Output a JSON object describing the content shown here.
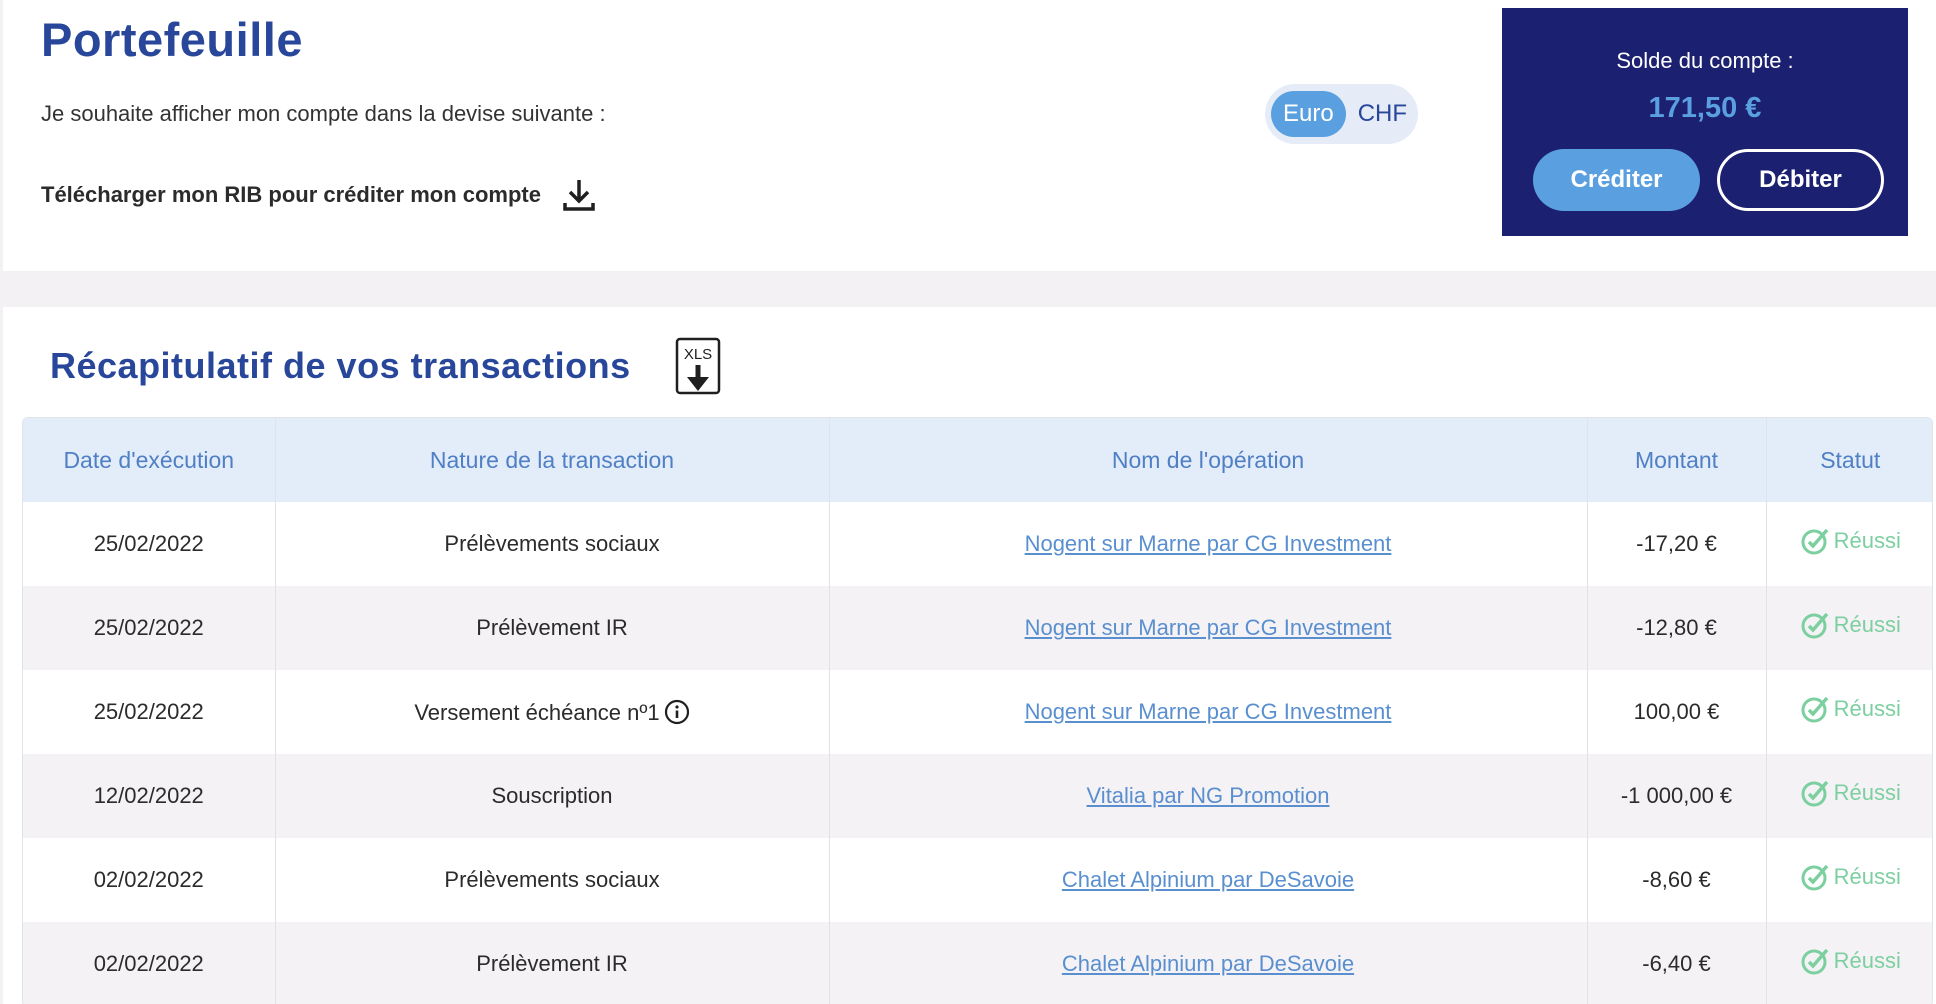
{
  "header": {
    "title": "Portefeuille",
    "currency_label": "Je souhaite afficher mon compte dans la devise suivante :",
    "rib_link": "Télécharger mon RIB pour créditer mon compte"
  },
  "currency_toggle": {
    "options": [
      "Euro",
      "CHF"
    ],
    "selected": "Euro"
  },
  "balance": {
    "label": "Solde du compte :",
    "value": "171,50 €",
    "credit_label": "Créditer",
    "debit_label": "Débiter"
  },
  "transactions": {
    "title": "Récapitulatif de vos transactions",
    "export_label": "XLS",
    "columns": [
      "Date d'exécution",
      "Nature de la transaction",
      "Nom de l'opération",
      "Montant",
      "Statut"
    ],
    "rows": [
      {
        "date": "25/02/2022",
        "nature": "Prélèvements sociaux",
        "operation": "Nogent sur Marne par CG Investment",
        "amount": "-17,20 €",
        "status": "Réussi"
      },
      {
        "date": "25/02/2022",
        "nature": "Prélèvement IR",
        "operation": "Nogent sur Marne par CG Investment",
        "amount": "-12,80 €",
        "status": "Réussi"
      },
      {
        "date": "25/02/2022",
        "nature": "Versement échéance nº1",
        "operation": "Nogent sur Marne par CG Investment",
        "amount": "100,00 €",
        "status": "Réussi",
        "info": true
      },
      {
        "date": "12/02/2022",
        "nature": "Souscription",
        "operation": "Vitalia par NG Promotion",
        "amount": "-1 000,00 €",
        "status": "Réussi"
      },
      {
        "date": "02/02/2022",
        "nature": "Prélèvements sociaux",
        "operation": "Chalet Alpinium par DeSavoie",
        "amount": "-8,60 €",
        "status": "Réussi"
      },
      {
        "date": "02/02/2022",
        "nature": "Prélèvement IR",
        "operation": "Chalet Alpinium par DeSavoie",
        "amount": "-6,40 €",
        "status": "Réussi"
      }
    ]
  },
  "colors": {
    "brand_blue": "#29479a",
    "accent_blue": "#5aa0e0",
    "card_navy": "#1b2070",
    "success_green": "#7ccf9f"
  }
}
